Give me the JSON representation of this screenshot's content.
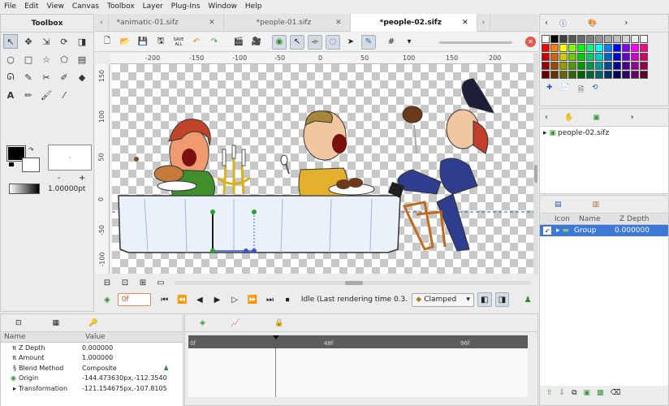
{
  "menu": [
    "File",
    "Edit",
    "View",
    "Canvas",
    "Toolbox",
    "Layer",
    "Plug-Ins",
    "Window",
    "Help"
  ],
  "toolbox": {
    "title": "Toolbox",
    "width_value": "1.00000pt",
    "minus": "-",
    "plus": "+"
  },
  "tabs": [
    {
      "label": "*animatic-01.sifz"
    },
    {
      "label": "*people-01.sifz"
    },
    {
      "label": "*people-02.sifz"
    }
  ],
  "ruler": {
    "h_ticks": [
      "-200",
      "-150",
      "-100",
      "-50",
      "0",
      "50",
      "100",
      "150",
      "200"
    ],
    "v_ticks": [
      "150",
      "100",
      "50",
      "0",
      "-50",
      "-100"
    ]
  },
  "toolbar": {
    "save_all": "SAVE ALL"
  },
  "framebar": {
    "current_frame": "0f",
    "status": "Idle (Last rendering time 0.3...",
    "interpolation": "Clamped"
  },
  "params": {
    "headers": {
      "name": "Name",
      "value": "Value"
    },
    "rows": [
      {
        "name": "Z Depth",
        "value": "0.000000"
      },
      {
        "name": "Amount",
        "value": "1.000000"
      },
      {
        "name": "Blend Method",
        "value": "Composite"
      },
      {
        "name": "Origin",
        "value": "-144.473630px,-112.3540"
      },
      {
        "name": "Transformation",
        "value": "-121.154675px,-107.8105"
      }
    ]
  },
  "timeline": {
    "marks": [
      "0f",
      "48f",
      "96f"
    ]
  },
  "canvas_browser": {
    "item": "people-02.sifz"
  },
  "layers": {
    "headers": {
      "icon": "Icon",
      "name": "Name",
      "zdepth": "Z Depth"
    },
    "rows": [
      {
        "name": "Group",
        "zdepth": "0.000000"
      }
    ]
  },
  "palette": {
    "colors": [
      "#ffffff",
      "#000000",
      "#3f3f3f",
      "#555555",
      "#6a6a6a",
      "#808080",
      "#959595",
      "#aaaaaa",
      "#bfbfbf",
      "#d4d4d4",
      "#eaeaea",
      "#ffffff",
      "#ff0000",
      "#ff7f00",
      "#ffff00",
      "#7fff00",
      "#00ff00",
      "#00ff7f",
      "#00ffff",
      "#007fff",
      "#0000ff",
      "#7f00ff",
      "#ff00ff",
      "#ff007f",
      "#cc0000",
      "#cc6600",
      "#cccc00",
      "#66cc00",
      "#00cc00",
      "#00cc66",
      "#00cccc",
      "#0066cc",
      "#0000cc",
      "#6600cc",
      "#cc00cc",
      "#cc0066",
      "#990000",
      "#994c00",
      "#999900",
      "#4c9900",
      "#009900",
      "#00994c",
      "#009999",
      "#004c99",
      "#000099",
      "#4c0099",
      "#990099",
      "#99004c",
      "#660000",
      "#663300",
      "#666600",
      "#336600",
      "#006600",
      "#006633",
      "#006666",
      "#003366",
      "#000066",
      "#330066",
      "#660066",
      "#660033"
    ],
    "outline_color": "#000000",
    "fill_color": "#ffffff"
  }
}
